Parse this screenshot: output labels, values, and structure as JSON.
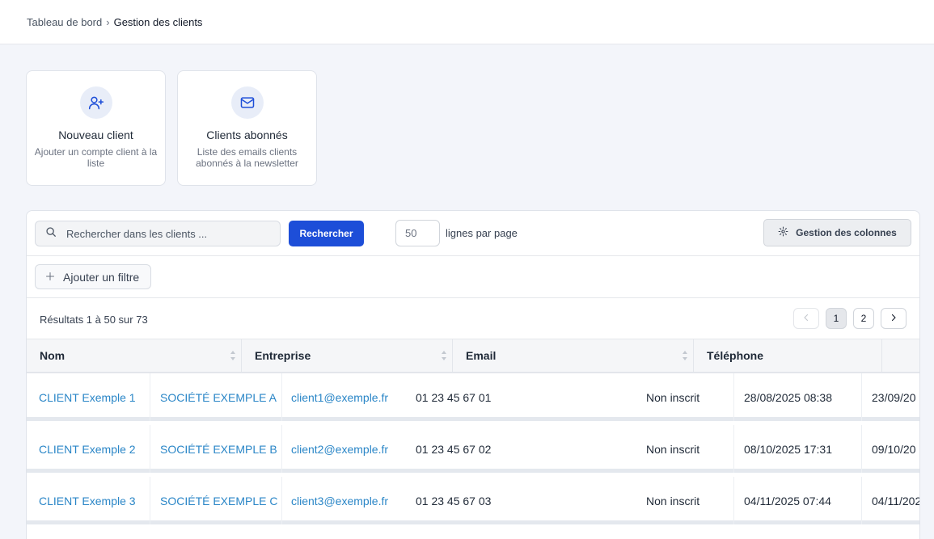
{
  "breadcrumb": {
    "parent": "Tableau de bord",
    "separator": "›",
    "current": "Gestion des clients"
  },
  "cards": [
    {
      "title": "Nouveau client",
      "description": "Ajouter un compte client à la liste",
      "icon": "user-plus-icon"
    },
    {
      "title": "Clients abonnés",
      "description": "Liste des emails clients abonnés à la newsletter",
      "icon": "mail-icon"
    }
  ],
  "toolbar": {
    "search_placeholder": "Rechercher dans les clients ...",
    "search_button": "Rechercher",
    "rows_per_page": "50",
    "rows_label": "lignes par page",
    "columns_button": "Gestion des colonnes"
  },
  "filter": {
    "add_label": "Ajouter un filtre"
  },
  "results": {
    "summary": "Résultats 1 à 50 sur 73"
  },
  "pagination": {
    "pages": [
      "1",
      "2"
    ],
    "current": "1"
  },
  "table": {
    "headers": [
      "Nom",
      "Entreprise",
      "Email",
      "Téléphone"
    ],
    "rows": [
      {
        "nom": "CLIENT Exemple 1",
        "entreprise": "SOCIÉTÉ EXEMPLE A",
        "email": "client1@exemple.fr",
        "telephone": "01 23 45 67 01",
        "newsletter": "Non inscrit",
        "date1": "28/08/2025 08:38",
        "date2": "23/09/20"
      },
      {
        "nom": "CLIENT Exemple 2",
        "entreprise": "SOCIÉTÉ EXEMPLE B",
        "email": "client2@exemple.fr",
        "telephone": "01 23 45 67 02",
        "newsletter": "Non inscrit",
        "date1": "08/10/2025 17:31",
        "date2": "09/10/20"
      },
      {
        "nom": "CLIENT Exemple 3",
        "entreprise": "SOCIÉTÉ EXEMPLE C",
        "email": "client3@exemple.fr",
        "telephone": "01 23 45 67 03",
        "newsletter": "Non inscrit",
        "date1": "04/11/2025 07:44",
        "date2": "04/11/202"
      }
    ]
  },
  "colors": {
    "primary": "#1d4ed8",
    "link": "#2a86c7",
    "background": "#f3f5fa"
  }
}
